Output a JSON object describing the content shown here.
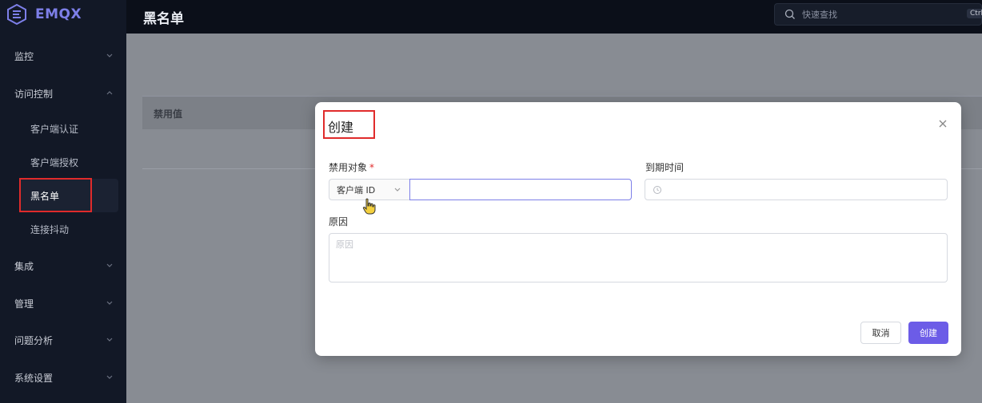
{
  "app": {
    "logo_text": "EMQX"
  },
  "sidebar": {
    "items": [
      {
        "label": "监控",
        "expanded": false
      },
      {
        "label": "访问控制",
        "expanded": true
      },
      {
        "label": "集成",
        "expanded": false
      },
      {
        "label": "管理",
        "expanded": false
      },
      {
        "label": "问题分析",
        "expanded": false
      },
      {
        "label": "系统设置",
        "expanded": false
      }
    ],
    "access_control_children": [
      {
        "label": "客户端认证",
        "active": false
      },
      {
        "label": "客户端授权",
        "active": false
      },
      {
        "label": "黑名单",
        "active": true
      },
      {
        "label": "连接抖动",
        "active": false
      }
    ]
  },
  "header": {
    "title": "黑名单",
    "search_placeholder": "快速查找",
    "search_shortcut": "Ctrl"
  },
  "table": {
    "column": "禁用值"
  },
  "dialog": {
    "title": "创建",
    "target_label": "禁用对象",
    "required_mark": "*",
    "target_type": "客户端 ID",
    "target_value": "",
    "expire_label": "到期时间",
    "reason_label": "原因",
    "reason_placeholder": "原因",
    "cancel_label": "取消",
    "create_label": "创建"
  },
  "colors": {
    "accent": "#6c5ce7",
    "highlight": "#e02b2b",
    "sidebar_bg": "#121826"
  }
}
